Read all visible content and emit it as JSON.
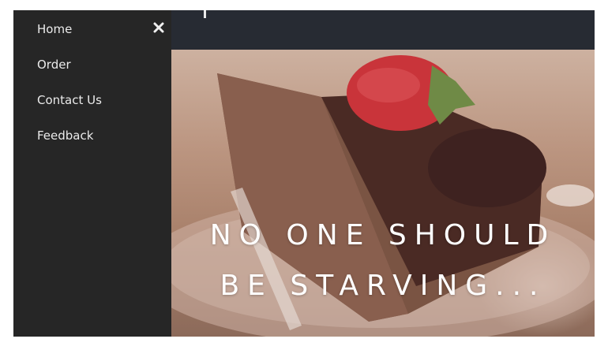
{
  "sidebar": {
    "items": [
      {
        "label": "Home"
      },
      {
        "label": "Order"
      },
      {
        "label": "Contact Us"
      },
      {
        "label": "Feedback"
      }
    ],
    "close_icon": "close-icon"
  },
  "hero": {
    "line1": "NO ONE SHOULD",
    "line2": "BE STARVING...",
    "image": "chocolate-cake-strawberry-photo"
  },
  "colors": {
    "sidebar_bg": "#262626",
    "topbar_bg": "#272b33",
    "nav_text": "#ebebeb",
    "hero_text": "#ffffff"
  }
}
